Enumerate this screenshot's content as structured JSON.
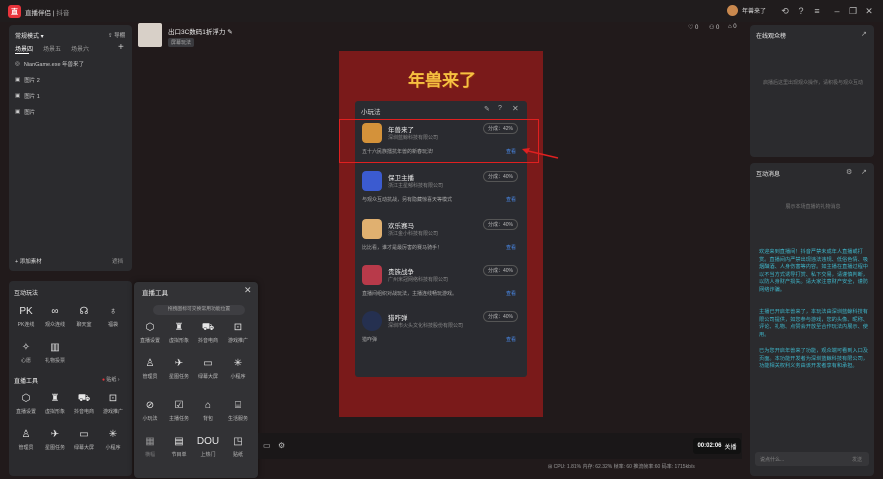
{
  "app": {
    "title": "直播伴侣",
    "subtitle": "抖音"
  },
  "user": {
    "name": "年兽来了"
  },
  "left_panel": {
    "mode": "常规模式",
    "import": "导棚",
    "tabs": [
      "场景四",
      "场景五",
      "场景六"
    ],
    "sources": [
      "NianGame.exe 年兽来了",
      "图片 2",
      "图片 1",
      "图片"
    ],
    "add_material": "添加素材",
    "lock": "遮挡"
  },
  "interaction": {
    "title": "互动玩法",
    "tools": [
      "PK连线",
      "观众连线",
      "聊天室",
      "福袋",
      "心愿",
      "礼物投票"
    ]
  },
  "broadcast": {
    "title": "直播工具",
    "badge": "贴纸",
    "tools": [
      "直播设置",
      "虚拟形象",
      "抖音电商",
      "游戏推广",
      "管理员",
      "星图任务",
      "绿幕大屏",
      "小程序"
    ]
  },
  "popup": {
    "title": "直播工具",
    "hint": "拖拽图标可交换常用功能位置",
    "tools": [
      "直播设置",
      "虚拟形象",
      "抖音电商",
      "游戏推广",
      "管理员",
      "星图任务",
      "绿幕大屏",
      "小程序",
      "小玩法",
      "主播任务",
      "背包",
      "生活服务",
      "横幅",
      "节目单",
      "上热门",
      "贴纸"
    ]
  },
  "stream": {
    "title": "出口3C数码1折浮力",
    "sub": "屏幕玩法",
    "likes": "0",
    "viewers": "0",
    "gifts": "0"
  },
  "minigame": {
    "title": "小玩法",
    "items": [
      {
        "name": "年兽来了",
        "company": "深圳蓝鲸科技有限公司",
        "share": "分成：42%",
        "desc": "五十六民族擂抗年兽的新春玩法!",
        "view": "查看"
      },
      {
        "name": "保卫主播",
        "company": "浙江主星郁科技有限公司",
        "share": "分成：40%",
        "desc": "与观众互动抗战，另有隐藏惊喜天等模式",
        "view": "查看"
      },
      {
        "name": "欢乐赛马",
        "company": "浙江金小科技有限公司",
        "share": "分成：40%",
        "desc": "比比看，谁才是最厉害的赛马骑手！",
        "view": "查看"
      },
      {
        "name": "贵族战争",
        "company": "广州米冠网络科技有限公司",
        "share": "分成：40%",
        "desc": "直播间组织对战玩法，主播连线畅玩游戏。",
        "view": "查看"
      },
      {
        "name": "猎咋弹",
        "company": "深圳市火头文化科技股份有限公司",
        "share": "分成：40%",
        "desc": "猎咋弹",
        "view": "查看"
      }
    ]
  },
  "banner": "年兽来了",
  "online": {
    "title": "在线观众榜",
    "empty": "启播后这里出现观众操作，请积极与观众互动"
  },
  "messages": {
    "title": "互动消息",
    "empty": "展示本场直播的礼物消息",
    "texts": [
      "欢迎来到直播间！抖音严禁未成年人直播或打赏。直播间内严禁出现违法违规、低俗色情、吸烟酗酒、人身伤害等内容。如主播在直播过程中以不当方式诱导打赏、私下交易，请谨慎判断，以防人身财产损失。请大家注意财产安全，谨防网络诈骗。",
      "主播已开启年兽来了，本玩法由深圳蓝鲸科技有限公司提供，如您参与游戏，您的头像、昵称、评论、礼物、点赞会开放至合作玩法内展示、使用。",
      "已为您开启年兽来了功能，观众端可看到入口及页面。本功能开发者为深圳蓝鲸科技有限公司，功能相关权利义务由该开发者享有和承担。"
    ],
    "input_placeholder": "说点什么...",
    "send": "发送"
  },
  "bottom": {
    "timer": "00:02:06",
    "stop": "关播"
  },
  "status": "CPU: 1.81%  内存: 62.32%  帧率: 60  推流帧率:60  码率: 1715kb/s",
  "colors": {
    "accent": "#e8343c",
    "link": "#4a8df0",
    "msg": "#3fb5c9",
    "highlight": "#e02020"
  }
}
